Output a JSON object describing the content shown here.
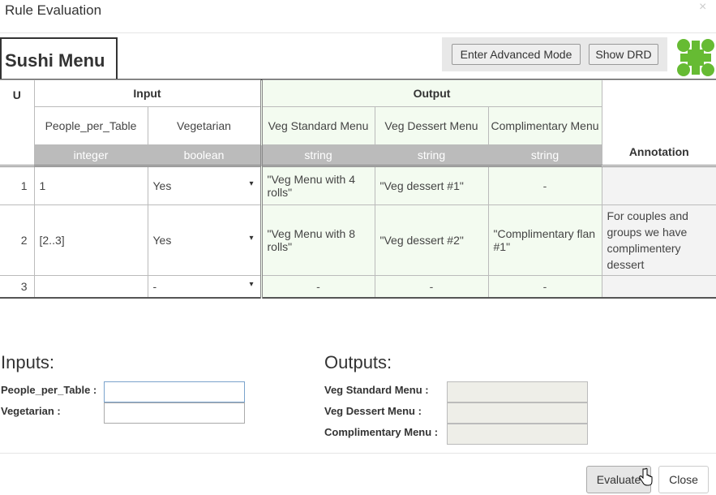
{
  "dialog": {
    "title": "Rule Evaluation",
    "close_glyph": "×"
  },
  "table": {
    "name": "Sushi Menu",
    "buttons": {
      "advanced": "Enter Advanced Mode",
      "drd": "Show DRD"
    },
    "hit_policy": "U",
    "input_group": "Input",
    "output_group": "Output",
    "annotation_header": "Annotation",
    "columns": {
      "people": {
        "name": "People_per_Table",
        "type": "integer"
      },
      "vegetarian": {
        "name": "Vegetarian",
        "type": "boolean"
      },
      "std_menu": {
        "name": "Veg Standard Menu",
        "type": "string"
      },
      "dessert": {
        "name": "Veg Dessert Menu",
        "type": "string"
      },
      "compl": {
        "name": "Complimentary Menu",
        "type": "string"
      }
    },
    "rows": [
      {
        "num": "1",
        "people": "1",
        "vegetarian": "Yes",
        "std_menu": "\"Veg Menu with 4 rolls\"",
        "dessert": "\"Veg dessert #1\"",
        "compl": "-",
        "annotation": ""
      },
      {
        "num": "2",
        "people": "[2..3]",
        "vegetarian": "Yes",
        "std_menu": "\"Veg Menu with 8 rolls\"",
        "dessert": "\"Veg dessert #2\"",
        "compl": "\"Complimentary flan #1\"",
        "annotation": "For couples and groups we have complimentery dessert"
      },
      {
        "num": "3",
        "people": "",
        "vegetarian": "-",
        "std_menu": "-",
        "dessert": "-",
        "compl": "-",
        "annotation": ""
      }
    ],
    "dropdown_glyph": "▾"
  },
  "inputs": {
    "title": "Inputs:",
    "people_label": "People_per_Table :",
    "people_value": "",
    "vegetarian_label": "Vegetarian :",
    "vegetarian_value": ""
  },
  "outputs": {
    "title": "Outputs:",
    "std_label": "Veg Standard Menu :",
    "dessert_label": "Veg Dessert Menu :",
    "compl_label": "Complimentary Menu :"
  },
  "footer": {
    "evaluate": "Evaluate",
    "close": "Close"
  },
  "colors": {
    "logo_green": "#66bb33",
    "output_bg": "#f3fbf0"
  }
}
